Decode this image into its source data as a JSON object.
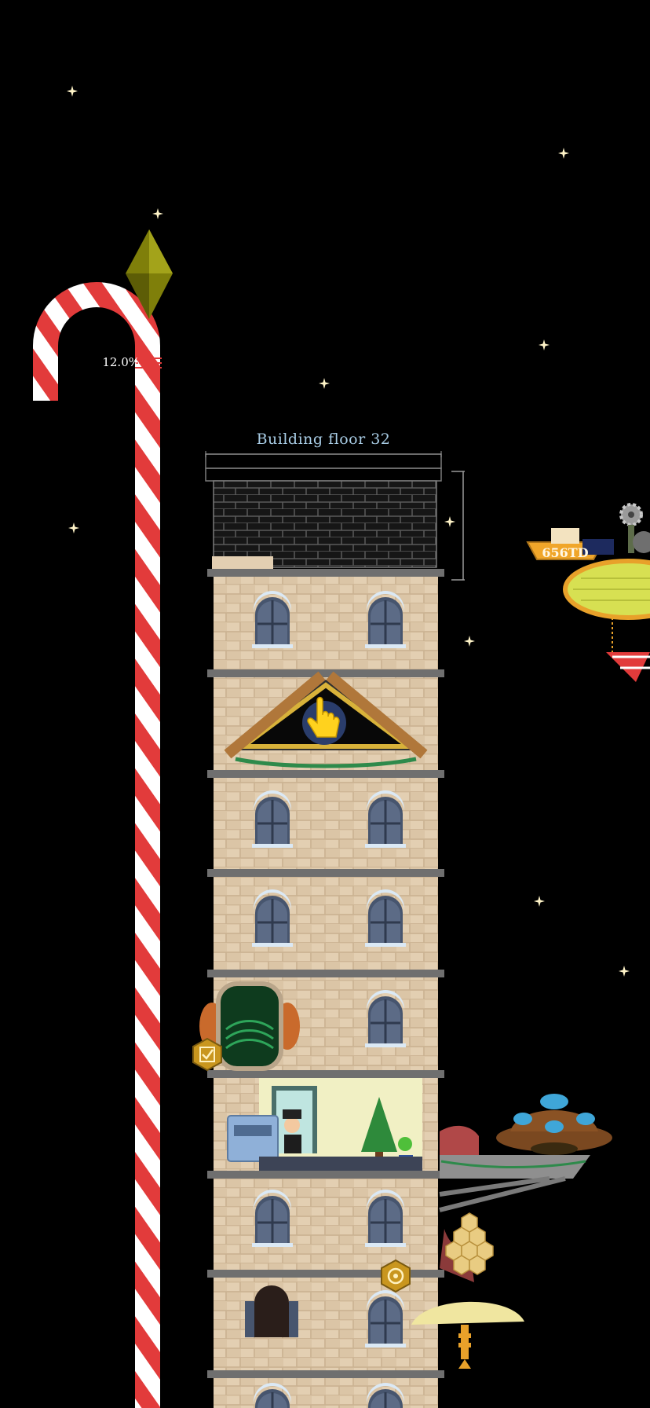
{
  "building": {
    "floor_label": "Building floor 32",
    "progress_label": "12.0%",
    "progress_percent": 12.0
  },
  "airship": {
    "price_label": "656TD"
  },
  "colors": {
    "background": "#000000",
    "tower_brick": "#dbc5a6",
    "floor_ledge": "#6f6f6f",
    "cane_red": "#e23b3b",
    "cane_white": "#ffffff",
    "gem": "#8f8f0f",
    "label_blue": "#a9cde6"
  },
  "icons": {
    "gem": "green-diamond-gem-icon",
    "hint": "pointing-hand-icon",
    "check_badge": "checkmark-hex-badge-icon",
    "target_badge": "target-hex-badge-icon",
    "gear": "gear-icon"
  }
}
